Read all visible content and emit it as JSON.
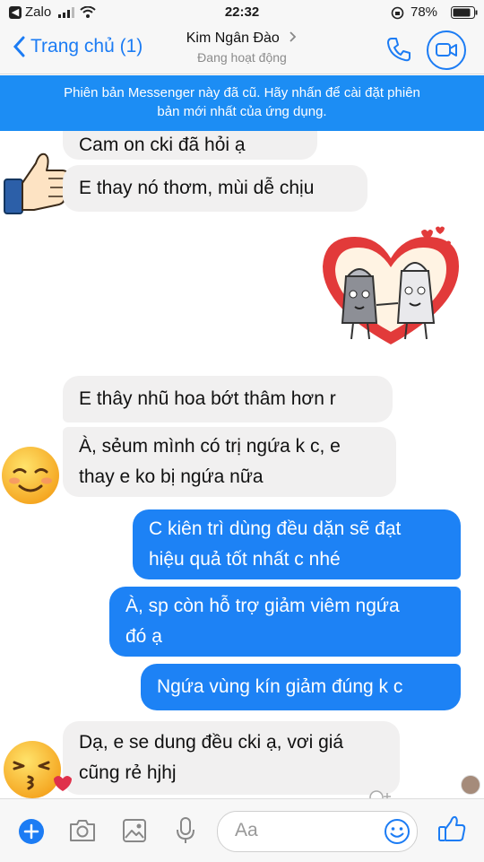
{
  "status_bar": {
    "back_app": "Zalo",
    "time": "22:32",
    "battery": "78%"
  },
  "header": {
    "back_label": "Trang chủ (1)",
    "contact_name": "Kim Ngân Đào",
    "contact_status": "Đang hoạt động"
  },
  "banner": {
    "line1": "Phiên bản Messenger này đã cũ. Hãy nhấn để cài đặt phiên",
    "line2": "bản mới nhất của ứng dụng."
  },
  "messages": {
    "m1": "Cam on cki đã hỏi ạ",
    "m2": "E thay nó thơm, mùi dễ chịu",
    "m3": "E thây nhũ hoa bớt thâm hơn r",
    "m4a": "À, sẻum mình có trị ngứa k c, e",
    "m4b": "thay e ko bị ngứa nữa",
    "m5a": "C kiên trì dùng đều dặn sẽ đạt",
    "m5b": "hiệu quả tốt nhất c nhé",
    "m6a": "À, sp còn hỗ trợ giảm viêm ngứa",
    "m6b": "đó ạ",
    "m7": "Ngứa vùng kín giảm đúng k c",
    "m8a": "Dạ, e se dung đều cki ạ, vơi giá",
    "m8b": "cũng rẻ hjhj"
  },
  "composer": {
    "placeholder": "Aa"
  },
  "colors": {
    "accent": "#1c7cf4",
    "banner": "#1c8df4",
    "outgoing_bubble": "#1d82f5",
    "incoming_bubble": "#f1f0f0"
  },
  "icons": {
    "status": [
      "back-arrow-icon",
      "signal-icon",
      "wifi-icon",
      "lock-rotation-icon",
      "battery-icon"
    ],
    "header": [
      "chevron-left-icon",
      "chevron-right-icon",
      "phone-icon",
      "video-camera-icon"
    ],
    "composer": [
      "plus-icon",
      "camera-icon",
      "image-icon",
      "microphone-icon",
      "smiley-icon",
      "thumbs-up-icon"
    ]
  }
}
